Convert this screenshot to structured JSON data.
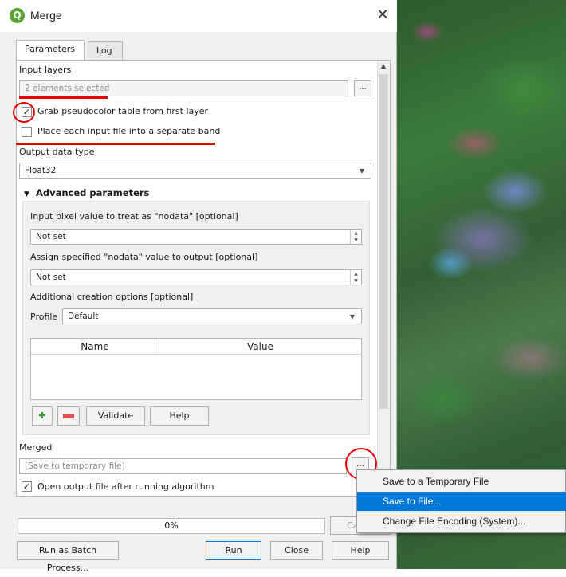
{
  "window": {
    "title": "Merge",
    "close": "✕"
  },
  "tabs": [
    "Parameters",
    "Log"
  ],
  "params": {
    "input_layers_label": "Input layers",
    "input_layers_value": "2 elements selected",
    "browse_label": "...",
    "grab_pseudocolor_label": "Grab pseudocolor table from first layer",
    "grab_pseudocolor_checked": true,
    "separate_band_label": "Place each input file into a separate band",
    "separate_band_checked": false,
    "output_type_label": "Output data type",
    "output_type_value": "Float32",
    "advanced": {
      "header": "Advanced parameters",
      "nodata_in_label": "Input pixel value to treat as \"nodata\" [optional]",
      "nodata_in_value": "Not set",
      "nodata_out_label": "Assign specified \"nodata\" value to output [optional]",
      "nodata_out_value": "Not set",
      "creation_label": "Additional creation options [optional]",
      "profile_label": "Profile",
      "profile_value": "Default",
      "table_headers": [
        "Name",
        "Value"
      ],
      "validate_label": "Validate",
      "help_label": "Help"
    },
    "merged_label": "Merged",
    "merged_placeholder": "[Save to temporary file]",
    "open_output_label": "Open output file after running algorithm",
    "open_output_checked": true
  },
  "progress": {
    "text": "0%",
    "value": 0
  },
  "buttons": {
    "cancel": "Ca",
    "batch": "Run as Batch Process...",
    "run": "Run",
    "close": "Close",
    "help": "Help"
  },
  "context_menu": {
    "items": [
      "Save to a Temporary File",
      "Save to File...",
      "Change File Encoding (System)..."
    ],
    "highlighted_index": 1
  },
  "colors": {
    "highlight": "#0078d7",
    "annotation": "#e60000",
    "qgis_green": "#5aa332"
  },
  "icons": [
    "qgis-logo-icon",
    "close-icon",
    "checkmark-icon",
    "triangle-down-icon",
    "add-row-icon",
    "remove-row-icon",
    "chevron-down-icon",
    "spin-updown-icon",
    "scroll-up-icon"
  ]
}
